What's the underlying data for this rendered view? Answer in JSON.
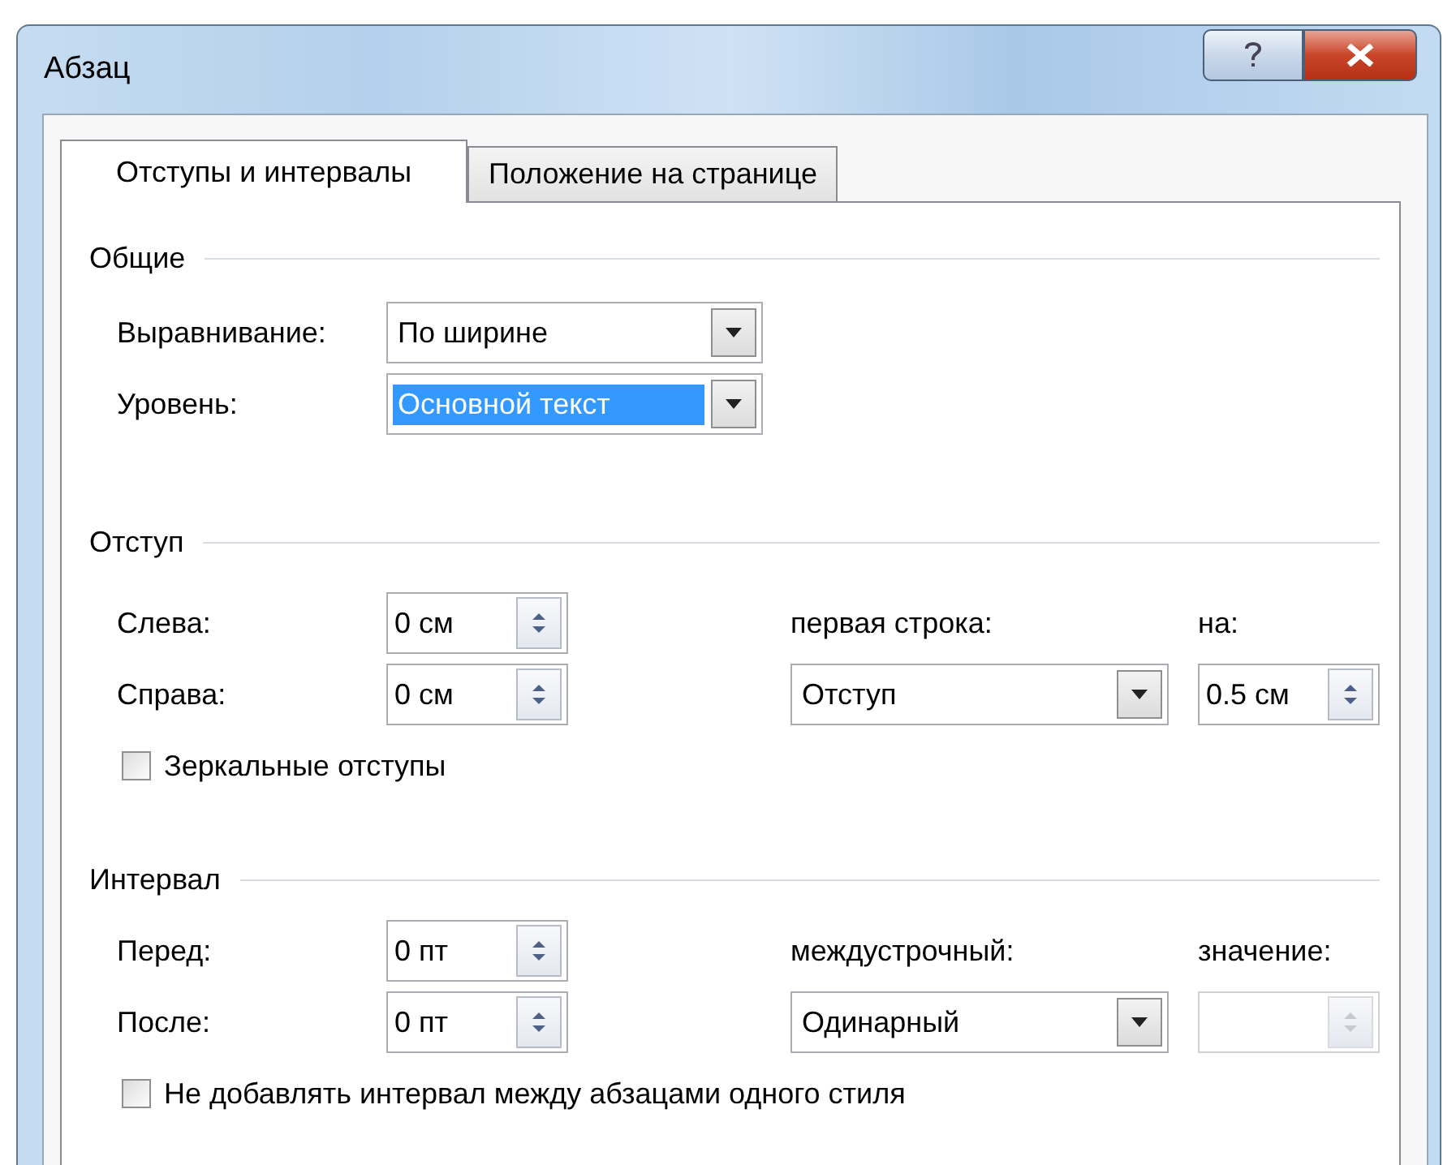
{
  "window": {
    "title": "Абзац"
  },
  "tabs": [
    {
      "label": "Отступы и интервалы",
      "selected": true
    },
    {
      "label": "Положение на странице",
      "selected": false
    }
  ],
  "general": {
    "heading": "Общие",
    "alignment": {
      "label": "Выравнивание:",
      "value": "По ширине",
      "highlighted": false
    },
    "level": {
      "label": "Уровень:",
      "value": "Основной текст",
      "highlighted": true
    }
  },
  "indent": {
    "heading": "Отступ",
    "left": {
      "label": "Слева:",
      "value": "0 см"
    },
    "right": {
      "label": "Справа:",
      "value": "0 см"
    },
    "first_line": {
      "label": "первая строка:",
      "value": "Отступ",
      "highlighted": false
    },
    "by": {
      "label": "на:",
      "value": "0.5 см",
      "disabled": false
    },
    "mirror": {
      "label": "Зеркальные отступы",
      "checked": false
    }
  },
  "spacing": {
    "heading": "Интервал",
    "before": {
      "label": "Перед:",
      "value": "0 пт"
    },
    "after": {
      "label": "После:",
      "value": "0 пт"
    },
    "line": {
      "label": "междустрочный:",
      "value": "Одинарный",
      "highlighted": false
    },
    "at": {
      "label": "значение:",
      "disabled": true
    },
    "no_space": {
      "label": "Не добавлять интервал между абзацами одного стиля",
      "checked": false
    }
  }
}
